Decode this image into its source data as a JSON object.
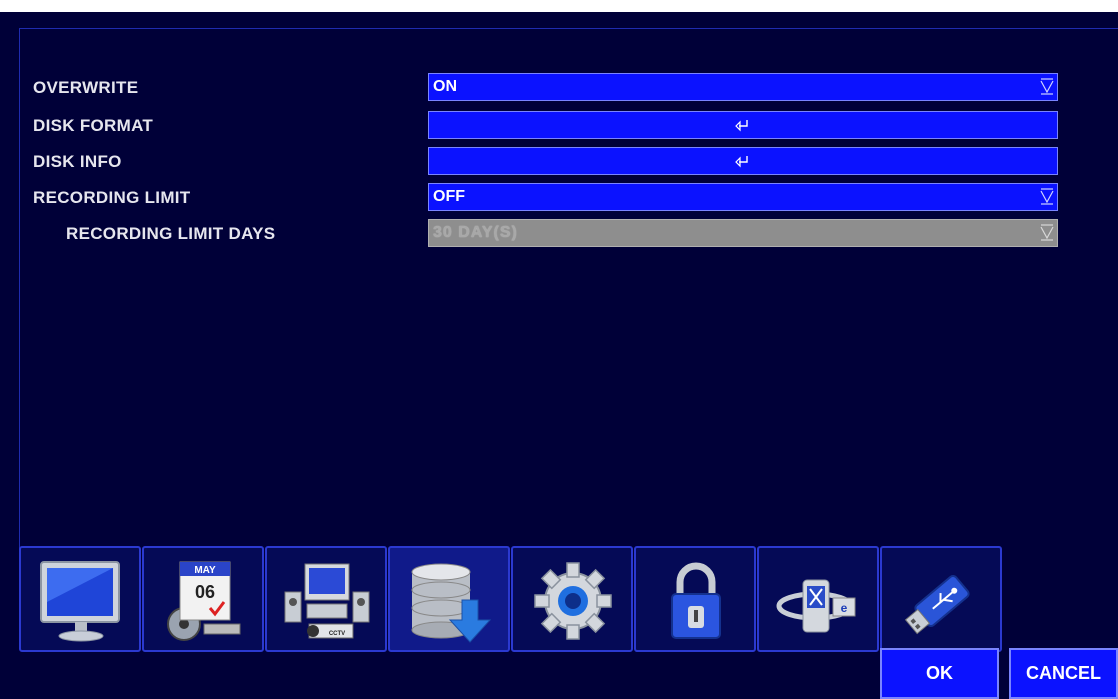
{
  "settings": {
    "rows": [
      {
        "label": "OVERWRITE",
        "value": "ON",
        "control": "dropdown"
      },
      {
        "label": "DISK FORMAT",
        "value": "",
        "control": "enter"
      },
      {
        "label": "DISK INFO",
        "value": "",
        "control": "enter"
      },
      {
        "label": "RECORDING LIMIT",
        "value": "OFF",
        "control": "dropdown"
      },
      {
        "label": "RECORDING LIMIT DAYS",
        "value": "30 DAY(S)",
        "control": "dropdown",
        "disabled": true
      }
    ]
  },
  "icon_bar": {
    "tabs": [
      {
        "icon": "monitor-icon"
      },
      {
        "icon": "calendar-schedule-icon",
        "month": "MAY",
        "day": "06"
      },
      {
        "icon": "device-camera-icon",
        "badge": "CCTV"
      },
      {
        "icon": "storage-disk-icon",
        "selected": true
      },
      {
        "icon": "gear-icon"
      },
      {
        "icon": "padlock-icon"
      },
      {
        "icon": "network-globe-icon",
        "badge": "e"
      },
      {
        "icon": "usb-drive-icon"
      }
    ]
  },
  "footer": {
    "ok_label": "OK",
    "cancel_label": "CANCEL"
  },
  "colors": {
    "background": "#000038",
    "field": "#0b12ff",
    "field_disabled": "#8e8e8e",
    "border": "#2b39d0"
  }
}
